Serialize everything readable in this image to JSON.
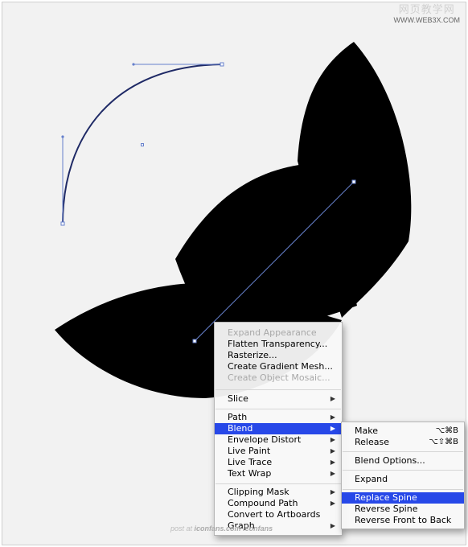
{
  "watermark": {
    "title": "网页教学网",
    "url": "WWW.WEB3X.COM"
  },
  "context_menu": {
    "items": [
      {
        "label": "Expand Appearance",
        "disabled": true,
        "submenu": false
      },
      {
        "label": "Flatten Transparency...",
        "disabled": false,
        "submenu": false
      },
      {
        "label": "Rasterize...",
        "disabled": false,
        "submenu": false
      },
      {
        "label": "Create Gradient Mesh...",
        "disabled": false,
        "submenu": false
      },
      {
        "label": "Create Object Mosaic...",
        "disabled": true,
        "submenu": false
      },
      {
        "label": "Slice",
        "disabled": false,
        "submenu": true
      },
      {
        "label": "Path",
        "disabled": false,
        "submenu": true
      },
      {
        "label": "Blend",
        "disabled": false,
        "submenu": true,
        "selected": true
      },
      {
        "label": "Envelope Distort",
        "disabled": false,
        "submenu": true
      },
      {
        "label": "Live Paint",
        "disabled": false,
        "submenu": true
      },
      {
        "label": "Live Trace",
        "disabled": false,
        "submenu": true
      },
      {
        "label": "Text Wrap",
        "disabled": false,
        "submenu": true
      },
      {
        "label": "Clipping Mask",
        "disabled": false,
        "submenu": true
      },
      {
        "label": "Compound Path",
        "disabled": false,
        "submenu": true
      },
      {
        "label": "Convert to Artboards",
        "disabled": false,
        "submenu": false
      },
      {
        "label": "Graph",
        "disabled": false,
        "submenu": true
      }
    ]
  },
  "blend_submenu": {
    "items": [
      {
        "label": "Make",
        "shortcut": "⌥⌘B"
      },
      {
        "label": "Release",
        "shortcut": "⌥⇧⌘B"
      },
      {
        "label": "Blend Options...",
        "shortcut": ""
      },
      {
        "label": "Expand",
        "shortcut": ""
      },
      {
        "label": "Replace Spine",
        "shortcut": "",
        "selected": true
      },
      {
        "label": "Reverse Spine",
        "shortcut": ""
      },
      {
        "label": "Reverse Front to Back",
        "shortcut": ""
      }
    ]
  },
  "footer": {
    "prefix": "post at",
    "site": "iconfans.com",
    "brand": "iconfans"
  },
  "colors": {
    "highlight": "#2748e8",
    "path_stroke": "#1f2a66",
    "shape_fill": "#000000",
    "anchor_line": "#6680cc"
  }
}
